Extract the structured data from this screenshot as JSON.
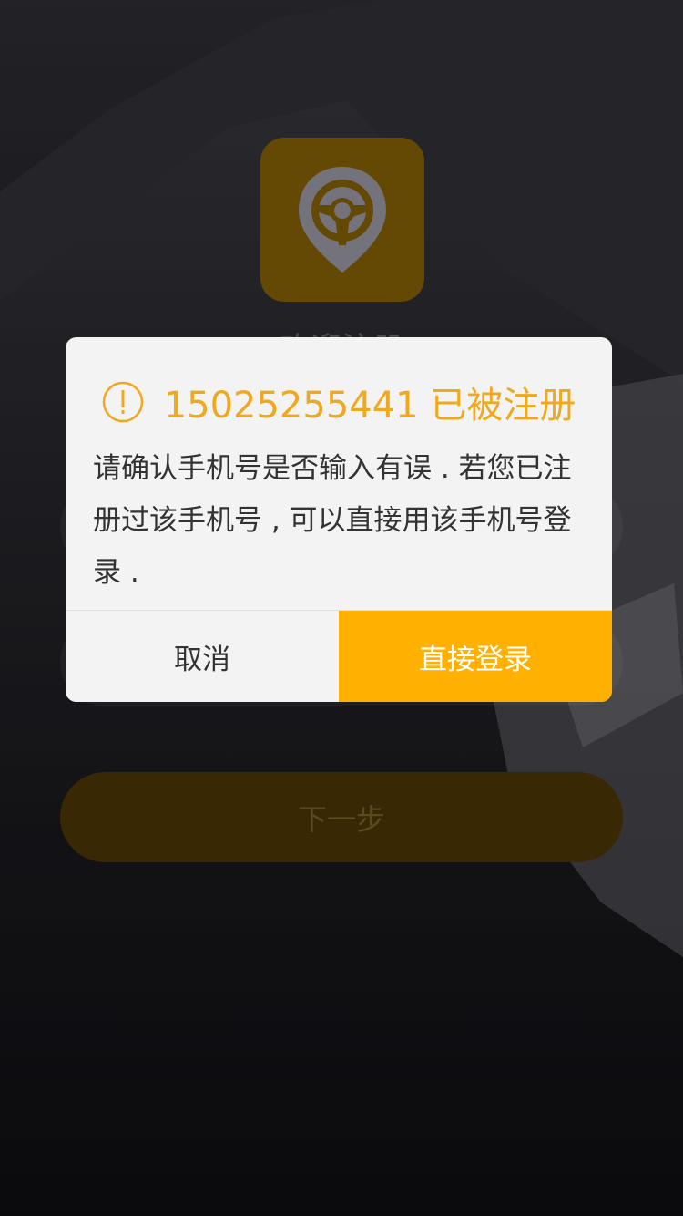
{
  "colors": {
    "accent": "#ffb001",
    "title_color": "#f0a81c",
    "logo_tile": "#7a5a05",
    "dialog_bg": "#f3f3f3",
    "next_button_bg": "#453104"
  },
  "background": {
    "welcome_text": "欢迎注册",
    "logo_icon": "steering-wheel-pin-icon"
  },
  "next_button": {
    "label": "下一步"
  },
  "dialog": {
    "icon": "warning-icon",
    "title": "15025255441 已被注册",
    "message": "请确认手机号是否输入有误 . 若您已注册过该手机号 , 可以直接用该手机号登录 .",
    "cancel_label": "取消",
    "confirm_label": "直接登录"
  }
}
